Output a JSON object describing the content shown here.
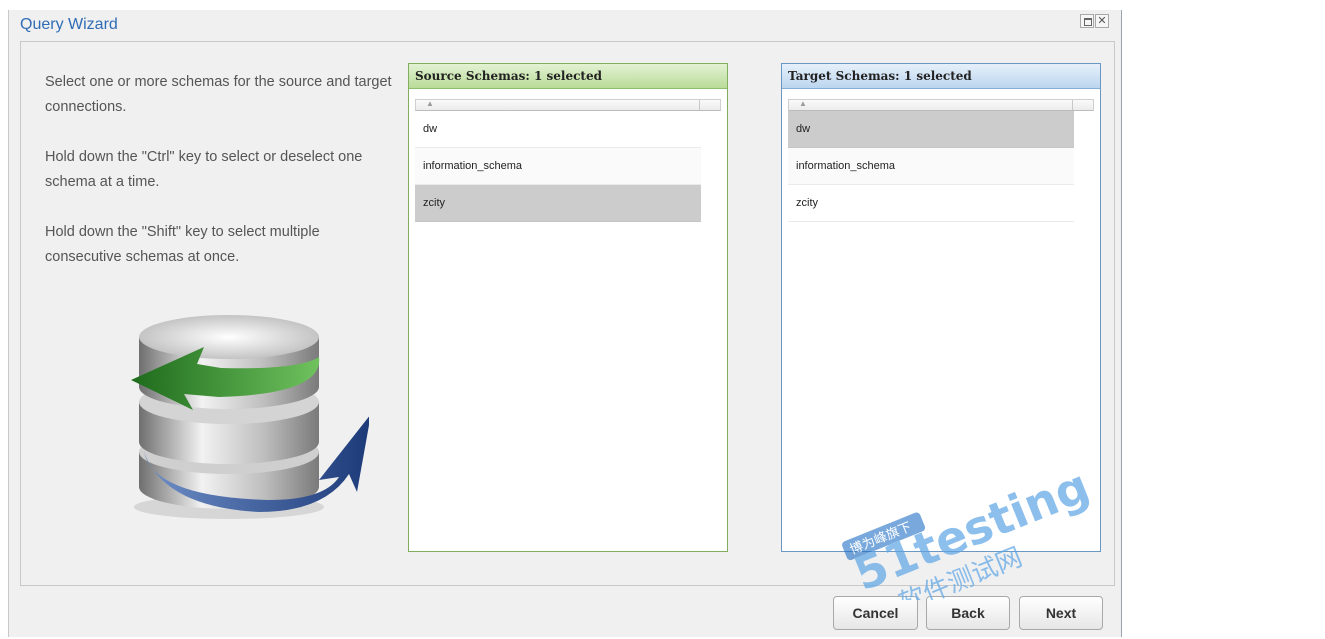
{
  "window": {
    "title": "Query Wizard",
    "maximize_icon": "maximize-icon",
    "close_icon": "close-icon",
    "close_glyph": "✕"
  },
  "instructions": {
    "p1": "Select one or more schemas for the source and target connections.",
    "p2": "Hold down the \"Ctrl\" key to select or deselect one schema at a time.",
    "p3": "Hold down the \"Shift\" key to select multiple consecutive schemas at once."
  },
  "illustration": {
    "icon": "database-sync-icon",
    "colors": {
      "green": "#2e8a2a",
      "blue": "#2b4f8f",
      "silver": "#bfbfbf"
    }
  },
  "source_panel": {
    "header": "Source Schemas: 1 selected",
    "sort_glyph": "▲",
    "accent": "#7fae5c",
    "rows": [
      {
        "label": "dw",
        "selected": false
      },
      {
        "label": "information_schema",
        "selected": false
      },
      {
        "label": "zcity",
        "selected": true
      }
    ]
  },
  "target_panel": {
    "header": "Target Schemas: 1 selected",
    "sort_glyph": "▲",
    "accent": "#6b97c4",
    "rows": [
      {
        "label": "dw",
        "selected": true
      },
      {
        "label": "information_schema",
        "selected": false
      },
      {
        "label": "zcity",
        "selected": false
      }
    ]
  },
  "buttons": {
    "cancel": "Cancel",
    "back": "Back",
    "next": "Next"
  },
  "watermark": {
    "main": "51testing",
    "sub": "软件测试网",
    "badge": "博为峰旗下"
  }
}
